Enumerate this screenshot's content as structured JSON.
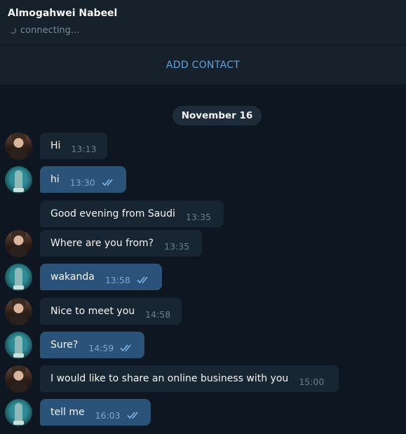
{
  "header": {
    "contact_name": "Almogahwei Nabeel",
    "status": "connecting..."
  },
  "add_contact": {
    "label": "ADD CONTACT"
  },
  "date_separator": "November 16",
  "messages": [
    {
      "direction": "incoming",
      "avatar": "contact-avatar",
      "text": "Hi",
      "time": "13:13",
      "read": false
    },
    {
      "direction": "outgoing",
      "avatar": "user-avatar",
      "text": "hi",
      "time": "13:30",
      "read": true
    },
    {
      "direction": "incoming",
      "avatar": "",
      "text": "Good evening from Saudi",
      "time": "13:35",
      "read": false
    },
    {
      "direction": "incoming",
      "avatar": "contact-avatar",
      "text": "Where are you from?",
      "time": "13:35",
      "read": false
    },
    {
      "direction": "outgoing",
      "avatar": "user-avatar",
      "text": "wakanda",
      "time": "13:58",
      "read": true
    },
    {
      "direction": "incoming",
      "avatar": "contact-avatar",
      "text": "Nice to meet you",
      "time": "14:58",
      "read": false
    },
    {
      "direction": "outgoing",
      "avatar": "user-avatar",
      "text": "Sure?",
      "time": "14:59",
      "read": true
    },
    {
      "direction": "incoming",
      "avatar": "contact-avatar",
      "text": "I would like to share an online business with you",
      "time": "15:00",
      "read": false
    },
    {
      "direction": "outgoing",
      "avatar": "user-avatar",
      "text": "tell me",
      "time": "16:03",
      "read": true
    }
  ],
  "colors": {
    "background": "#0e1621",
    "header": "#17212b",
    "incoming_bubble": "#182533",
    "outgoing_bubble": "#2b5278",
    "accent": "#5ca3e6"
  }
}
